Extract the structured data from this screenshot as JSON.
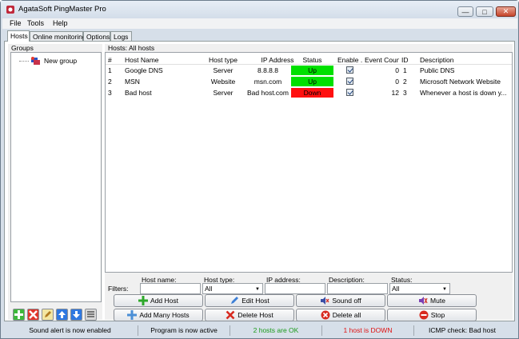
{
  "window": {
    "title": "AgataSoft PingMaster Pro",
    "min": "—",
    "max": "□",
    "close": "✕"
  },
  "menu": [
    "File",
    "Tools",
    "Help"
  ],
  "tabs": [
    "Hosts",
    "Online monitoring",
    "Options",
    "Logs"
  ],
  "groups": {
    "label": "Groups",
    "items": [
      "New group"
    ]
  },
  "hosts": {
    "label": "Hosts: All hosts",
    "columns": [
      "#",
      "Host Name",
      "Host type",
      "IP Address",
      "Status",
      "Enable ...",
      "Event Count",
      "ID",
      "Description"
    ],
    "rows": [
      {
        "num": "1",
        "name": "Google DNS",
        "type": "Server",
        "ip": "8.8.8.8",
        "status": "Up",
        "enabled": true,
        "count": "0",
        "id": "1",
        "desc": "Public DNS"
      },
      {
        "num": "2",
        "name": "MSN",
        "type": "Website",
        "ip": "msn.com",
        "status": "Up",
        "enabled": true,
        "count": "0",
        "id": "2",
        "desc": "Microsoft Network Website"
      },
      {
        "num": "3",
        "name": "Bad host",
        "type": "Server",
        "ip": "Bad host.com",
        "status": "Down",
        "enabled": true,
        "count": "12",
        "id": "3",
        "desc": "Whenever a host is down y..."
      }
    ]
  },
  "filters": {
    "label": "Filters:",
    "host_name_label": "Host name:",
    "host_type_label": "Host type:",
    "ip_label": "IP address:",
    "desc_label": "Description:",
    "status_label": "Status:",
    "host_type_value": "All",
    "status_value": "All"
  },
  "actions": {
    "add_host": "Add Host",
    "edit_host": "Edit Host",
    "sound_off": "Sound off",
    "mute": "Mute",
    "add_many": "Add Many Hosts",
    "delete_host": "Delete Host",
    "delete_all": "Delete all",
    "stop": "Stop"
  },
  "statusbar": {
    "sound": "Sound alert is now enabled",
    "program": "Program is now active",
    "ok": "2 hosts are OK",
    "down": "1 host is DOWN",
    "icmp": "ICMP check: Bad host"
  },
  "colors": {
    "up": "#00e000",
    "down": "#ff1010",
    "ok_text": "#1a9a1a",
    "down_text": "#e01010"
  }
}
